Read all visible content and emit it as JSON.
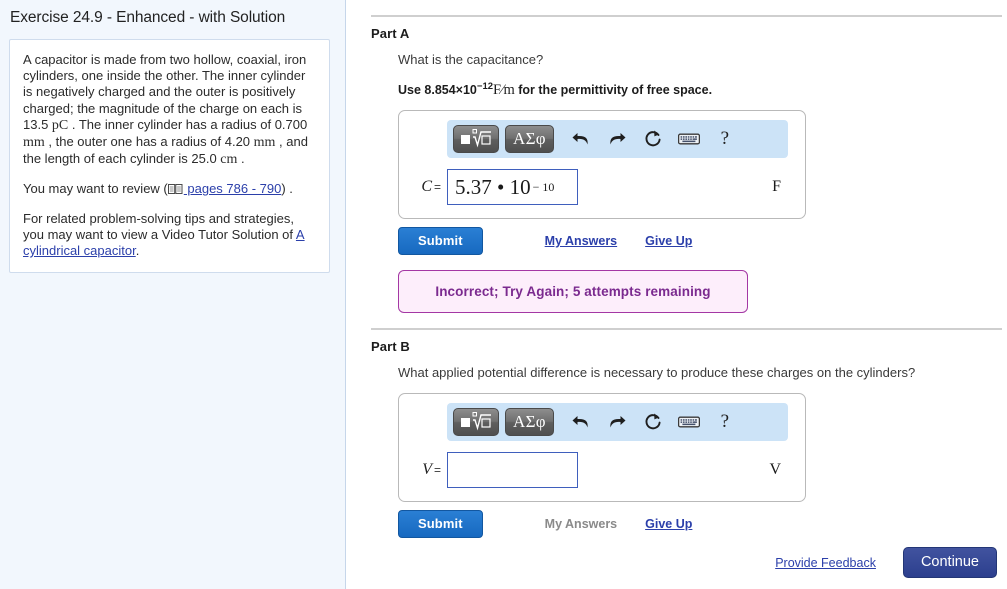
{
  "sidebar": {
    "exercise_title": "Exercise 24.9 - Enhanced - with Solution",
    "problem": {
      "para1_a": "A capacitor is made from two hollow, coaxial, iron cylinders, one inside the other. The inner cylinder is negatively charged and the outer is positively charged; the magnitude of the charge on each is 13.5 ",
      "unit_pC": "pC",
      "para1_b": " . The inner cylinder has a radius of 0.700 ",
      "unit_mm1": "mm",
      "para1_c": " , the outer one has a radius of 4.20 ",
      "unit_mm2": "mm",
      "para1_d": " , and the length of each cylinder is 25.0 ",
      "unit_cm": "cm",
      "para1_e": " .",
      "para2_prefix": "You may want to review (",
      "review_link": " pages 786 - 790",
      "para2_suffix": ") .",
      "para3_prefix": "For related problem-solving tips and strategies, you may want to view a Video Tutor Solution of ",
      "video_link": "A cylindrical capacitor",
      "para3_suffix": "."
    }
  },
  "parts": [
    {
      "label": "Part A",
      "question": "What is the capacitance?",
      "hint_prefix": "Use 8.854×10",
      "hint_exponent": "−12",
      "hint_unit": "F∕m",
      "hint_suffix": " for the permittivity of free space.",
      "variable": "C",
      "equals": "=",
      "answer_value": "5.37 • 10",
      "answer_exponent": "− 10",
      "unit": "F",
      "submit_label": "Submit",
      "my_answers_label": "My Answers",
      "my_answers_enabled": true,
      "give_up_label": "Give Up",
      "feedback": "Incorrect; Try Again; 5 attempts remaining"
    },
    {
      "label": "Part B",
      "question": "What applied potential difference is necessary to produce these charges on the cylinders?",
      "variable": "V",
      "equals": "=",
      "answer_value": "",
      "answer_exponent": "",
      "unit": "V",
      "submit_label": "Submit",
      "my_answers_label": "My Answers",
      "my_answers_enabled": false,
      "give_up_label": "Give Up"
    }
  ],
  "toolbar": {
    "template_button_label": "template-icon",
    "greek_button_label": "ΑΣφ",
    "undo_label": "undo-icon",
    "redo_label": "redo-icon",
    "reset_label": "reset-icon",
    "keyboard_label": "keyboard-icon",
    "help_label": "?"
  },
  "footer": {
    "provide_feedback": "Provide Feedback",
    "continue_label": "Continue"
  },
  "colors": {
    "sidebar_bg": "#f2f7fd",
    "toolbar_bg": "#cce3f7",
    "submit_blue": "#1769c0",
    "link_blue": "#2b3faa",
    "feedback_purple": "#7b2a8f",
    "feedback_bg": "#fdeefb",
    "continue_blue": "#2c3f8e"
  }
}
